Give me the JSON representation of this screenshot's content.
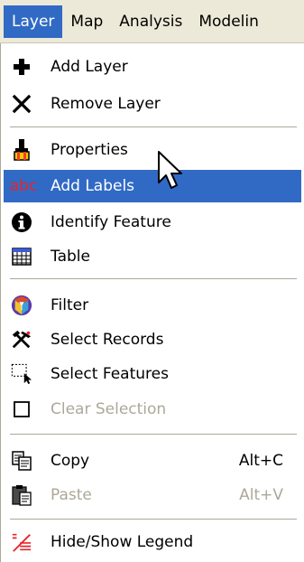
{
  "menubar": {
    "items": [
      "Layer",
      "Map",
      "Analysis",
      "Modelin"
    ]
  },
  "menu": {
    "add_layer": "Add Layer",
    "remove_layer": "Remove Layer",
    "properties": "Properties",
    "add_labels": "Add Labels",
    "add_labels_icon_text": "abc",
    "identify_feature": "Identify Feature",
    "table": "Table",
    "filter": "Filter",
    "select_records": "Select Records",
    "select_features": "Select Features",
    "clear_selection": "Clear Selection",
    "copy": "Copy",
    "copy_shortcut": "Alt+C",
    "paste": "Paste",
    "paste_shortcut": "Alt+V",
    "hide_show_legend": "Hide/Show Legend"
  },
  "state": {
    "highlighted_item": "Add Labels",
    "disabled_items": [
      "Clear Selection",
      "Paste"
    ]
  },
  "colors": {
    "highlight": "#316ac5",
    "menubar_bg": "#ece9d8",
    "disabled_text": "#aca899"
  }
}
